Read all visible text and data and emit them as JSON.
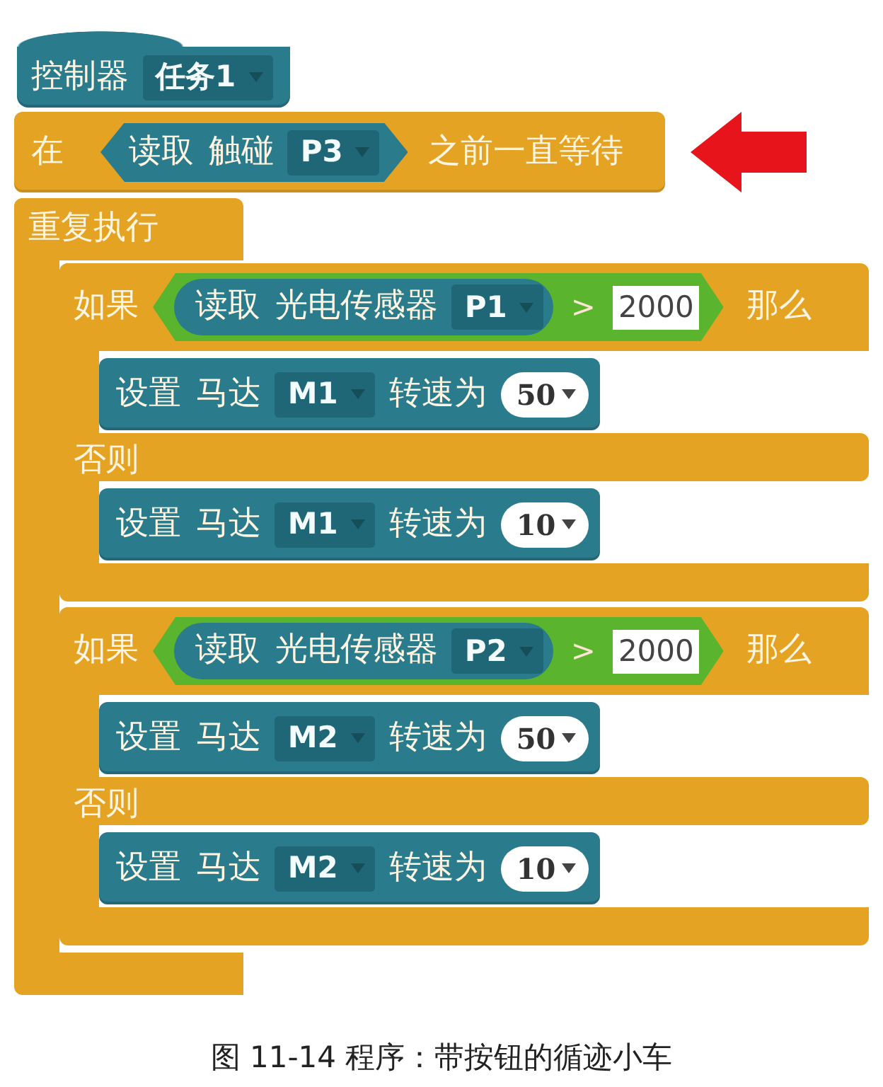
{
  "blocks": [
    {
      "kind": "controller",
      "label": "控制器",
      "dropdown": "任务1"
    },
    {
      "kind": "wait_until",
      "label": "在",
      "condition": {
        "label": "读取 触碰",
        "dropdown": "P3"
      },
      "suffix": "之前一直等待"
    },
    {
      "kind": "repeat",
      "label": "重复执行",
      "body": [
        {
          "kind": "if_else",
          "if_label": "如果",
          "condition": {
            "sensor_label": "读取 光电传感器",
            "port": "P1",
            "operator": ">",
            "threshold": "2000"
          },
          "then_label": "那么",
          "then": [
            {
              "kind": "set_motor",
              "label": "设置 马达",
              "motor": "M1",
              "speed_label": "转速为",
              "speed": "50"
            }
          ],
          "else_label": "否则",
          "else": [
            {
              "kind": "set_motor",
              "label": "设置 马达",
              "motor": "M1",
              "speed_label": "转速为",
              "speed": "10"
            }
          ]
        },
        {
          "kind": "if_else",
          "if_label": "如果",
          "condition": {
            "sensor_label": "读取 光电传感器",
            "port": "P2",
            "operator": ">",
            "threshold": "2000"
          },
          "then_label": "那么",
          "then": [
            {
              "kind": "set_motor",
              "label": "设置 马达",
              "motor": "M2",
              "speed_label": "转速为",
              "speed": "50"
            }
          ],
          "else_label": "否则",
          "else": [
            {
              "kind": "set_motor",
              "label": "设置 马达",
              "motor": "M2",
              "speed_label": "转速为",
              "speed": "10"
            }
          ]
        }
      ]
    }
  ],
  "caption": "图 11-14 程序：带按钮的循迹小车"
}
